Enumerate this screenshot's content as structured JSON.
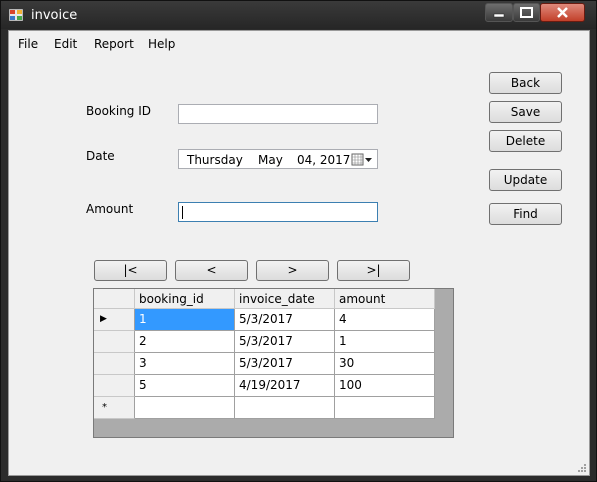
{
  "window": {
    "title": "invoice"
  },
  "menu": [
    "File",
    "Edit",
    "Report",
    "Help"
  ],
  "form": {
    "booking_id_label": "Booking ID",
    "booking_id_value": "",
    "date_label": "Date",
    "date": {
      "day": "Thursday",
      "sep": ",",
      "month": "May",
      "rest": "04, 2017"
    },
    "amount_label": "Amount",
    "amount_value": ""
  },
  "buttons": {
    "back": "Back",
    "save": "Save",
    "delete": "Delete",
    "update": "Update",
    "find": "Find"
  },
  "nav": {
    "first": "|<",
    "prev": "<",
    "next": ">",
    "last": ">|"
  },
  "grid": {
    "columns": [
      "booking_id",
      "invoice_date",
      "amount"
    ],
    "rows": [
      [
        "1",
        "5/3/2017",
        "4"
      ],
      [
        "2",
        "5/3/2017",
        "1"
      ],
      [
        "3",
        "5/3/2017",
        "30"
      ],
      [
        "5",
        "4/19/2017",
        "100"
      ]
    ],
    "current_row_marker": "▶",
    "new_row_marker": "*"
  }
}
